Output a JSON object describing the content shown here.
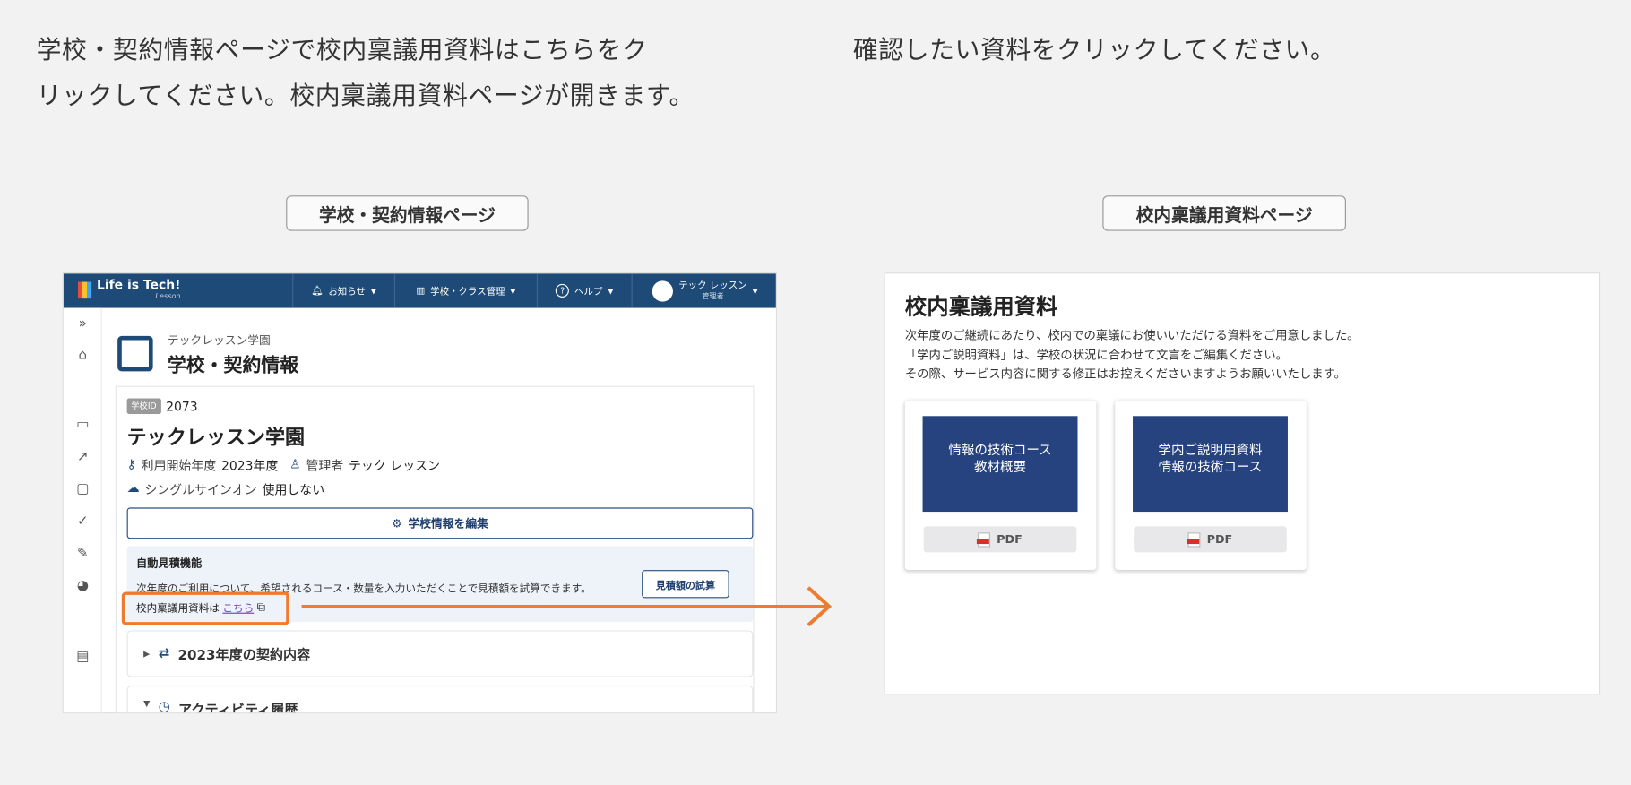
{
  "instructions": {
    "left_line1": "学校・契約情報ページで校内稟議用資料はこちらをク",
    "left_line2": "リックしてください。校内稟議用資料ページが開きます。",
    "right": "確認したい資料をクリックしてください。"
  },
  "labels": {
    "left_page": "学校・契約情報ページ",
    "right_page": "校内稟議用資料ページ"
  },
  "accent_color": "#f07a30",
  "app": {
    "logo": "Life is Tech!",
    "logo_sub": "Lesson",
    "nav": {
      "notices": "お知らせ",
      "school_class": "学校・クラス管理",
      "help": "ヘルプ",
      "user_name": "テック レッスン",
      "user_role": "管理者"
    },
    "header": {
      "subtitle": "テックレッスン学園",
      "title": "学校・契約情報"
    },
    "school": {
      "id_badge": "学校ID",
      "id": "2073",
      "name": "テックレッスン学園",
      "start_label": "利用開始年度",
      "start_value": "2023年度",
      "admin_label": "管理者",
      "admin_value": "テック レッスン",
      "sso_label": "シングルサインオン",
      "sso_value": "使用しない",
      "edit_button": "学校情報を編集"
    },
    "estimate": {
      "title": "自動見積機能",
      "description": "次年度のご利用について、希望されるコース・数量を入力いただくことで見積額を試算できます。",
      "button": "見積額の試算",
      "link_prefix": "校内稟議用資料は",
      "link": "こちら"
    },
    "accordions": [
      "2023年度の契約内容",
      "アクティビティ履歴"
    ]
  },
  "materials": {
    "title": "校内稟議用資料",
    "lines": [
      "次年度のご継続にあたり、校内での稟議にお使いいただける資料をご用意しました。",
      "「学内ご説明資料」は、学校の状況に合わせて文言をご編集ください。",
      "その際、サービス内容に関する修正はお控えくださいますようお願いいたします。"
    ],
    "cards": [
      {
        "title": "情報の技術コース\n教材概要",
        "button": "PDF"
      },
      {
        "title": "学内ご説明用資料\n情報の技術コース",
        "button": "PDF"
      }
    ]
  }
}
